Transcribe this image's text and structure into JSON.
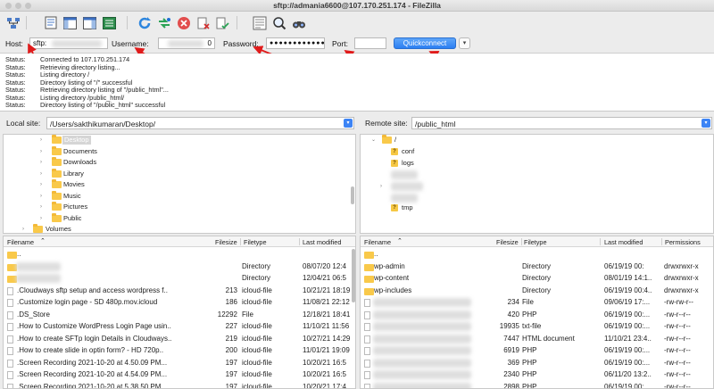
{
  "window": {
    "title": "sftp://admania6600@107.170.251.174 - FileZilla"
  },
  "toolbar": {
    "icons": [
      "site-manager-icon",
      "message-log-icon",
      "local-tree-icon",
      "remote-tree-icon",
      "transfer-queue-icon",
      "refresh-icon",
      "process-queue-icon",
      "cancel-icon",
      "disconnect-icon",
      "reconnect-icon",
      "directory-filter-icon",
      "search-icon",
      "find-files-icon"
    ]
  },
  "quickconnect": {
    "host_label": "Host:",
    "host_value": "sftp:",
    "username_label": "Username:",
    "username_value": "0",
    "password_label": "Password:",
    "password_value": "●●●●●●●●●●●●●●",
    "port_label": "Port:",
    "port_value": "",
    "button_label": "Quickconnect",
    "dropdown_icon": "▾",
    "accent_color": "#2f82f4"
  },
  "log": [
    {
      "key": "Status:",
      "msg": "Connected to 107.170.251.174"
    },
    {
      "key": "Status:",
      "msg": "Retrieving directory listing..."
    },
    {
      "key": "Status:",
      "msg": "Listing directory /"
    },
    {
      "key": "Status:",
      "msg": "Directory listing of \"/\" successful"
    },
    {
      "key": "Status:",
      "msg": "Retrieving directory listing of \"/public_html\"..."
    },
    {
      "key": "Status:",
      "msg": "Listing directory /public_html/"
    },
    {
      "key": "Status:",
      "msg": "Directory listing of \"/public_html\" successful"
    }
  ],
  "local": {
    "site_label": "Local site:",
    "path": "/Users/sakthikumaran/Desktop/",
    "tree": [
      "Desktop",
      "Documents",
      "Downloads",
      "Library",
      "Movies",
      "Music",
      "Pictures",
      "Public",
      "Volumes"
    ],
    "columns": {
      "name": "Filename",
      "size": "Filesize",
      "type": "Filetype",
      "modified": "Last modified"
    },
    "files": [
      {
        "name": "..",
        "size": "",
        "type": "",
        "modified": ""
      },
      {
        "name": "",
        "size": "",
        "type": "Directory",
        "modified": "08/07/20 12:4"
      },
      {
        "name": "",
        "size": "",
        "type": "Directory",
        "modified": "12/04/21 06:5"
      },
      {
        "name": ".Cloudways sftp setup and access wordpress f..",
        "size": "213",
        "type": "icloud-file",
        "modified": "10/21/21 18:19"
      },
      {
        "name": ".Customize login page - SD 480p.mov.icloud",
        "size": "186",
        "type": "icloud-file",
        "modified": "11/08/21 22:12"
      },
      {
        "name": ".DS_Store",
        "size": "12292",
        "type": "File",
        "modified": "12/18/21 18:41"
      },
      {
        "name": ".How to Customize WordPress Login Page usin..",
        "size": "227",
        "type": "icloud-file",
        "modified": "11/10/21 11:56"
      },
      {
        "name": ".How to create SFTp login Details in Cloudways..",
        "size": "219",
        "type": "icloud-file",
        "modified": "10/27/21 14:29"
      },
      {
        "name": ".How to create slide in optin form? - HD 720p..",
        "size": "200",
        "type": "icloud-file",
        "modified": "11/01/21 19:09"
      },
      {
        "name": ".Screen Recording 2021-10-20 at 4.50.09 PM...",
        "size": "197",
        "type": "icloud-file",
        "modified": "10/20/21 16:5"
      },
      {
        "name": ".Screen Recording 2021-10-20 at 4.54.09 PM...",
        "size": "197",
        "type": "icloud-file",
        "modified": "10/20/21 16:5"
      },
      {
        "name": ".Screen Recording 2021-10-20 at 5.38.50 PM...",
        "size": "197",
        "type": "icloud-file",
        "modified": "10/20/21 17:4"
      }
    ]
  },
  "remote": {
    "site_label": "Remote site:",
    "path": "/public_html",
    "tree": [
      "/",
      "conf",
      "logs",
      "tmp"
    ],
    "columns": {
      "name": "Filename",
      "size": "Filesize",
      "type": "Filetype",
      "modified": "Last modified",
      "perms": "Permissions"
    },
    "files": [
      {
        "name": "..",
        "size": "",
        "type": "",
        "modified": "",
        "perms": ""
      },
      {
        "name": "wp-admin",
        "size": "",
        "type": "Directory",
        "modified": "06/19/19 00:",
        "perms": "drwxrwxr-x"
      },
      {
        "name": "wp-content",
        "size": "",
        "type": "Directory",
        "modified": "08/01/19 14:1..",
        "perms": "drwxrwxr-x"
      },
      {
        "name": "wp-includes",
        "size": "",
        "type": "Directory",
        "modified": "06/19/19 00:4..",
        "perms": "drwxrwxr-x"
      },
      {
        "name": "",
        "size": "234",
        "type": "File",
        "modified": "09/06/19 17:...",
        "perms": "-rw-rw-r--"
      },
      {
        "name": "",
        "size": "420",
        "type": "PHP",
        "modified": "06/19/19 00:...",
        "perms": "-rw-r--r--"
      },
      {
        "name": "",
        "size": "19935",
        "type": "txt-file",
        "modified": "06/19/19 00:...",
        "perms": "-rw-r--r--"
      },
      {
        "name": "",
        "size": "7447",
        "type": "HTML document",
        "modified": "11/10/21 23:4..",
        "perms": "-rw-r--r--"
      },
      {
        "name": "",
        "size": "6919",
        "type": "PHP",
        "modified": "06/19/19 00:...",
        "perms": "-rw-r--r--"
      },
      {
        "name": "",
        "size": "369",
        "type": "PHP",
        "modified": "06/19/19 00:...",
        "perms": "-rw-r--r--"
      },
      {
        "name": "",
        "size": "2340",
        "type": "PHP",
        "modified": "06/11/20 13:2..",
        "perms": "-rw-r--r--"
      },
      {
        "name": "",
        "size": "2898",
        "type": "PHP",
        "modified": "06/19/19 00:...",
        "perms": "-rw-r--r--"
      }
    ]
  }
}
